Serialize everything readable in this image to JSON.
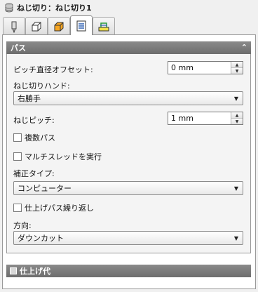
{
  "title": "ねじ切り：ねじ切り1",
  "tabs": [
    {
      "icon": "tool-icon"
    },
    {
      "icon": "holder-icon"
    },
    {
      "icon": "geometry-icon"
    },
    {
      "icon": "passes-icon",
      "active": true
    },
    {
      "icon": "linking-icon"
    }
  ],
  "section": {
    "title": "パス",
    "collapse_icon": "double-chevron-up-icon",
    "pitch_offset": {
      "label": "ピッチ直径オフセット:",
      "value": "0 mm"
    },
    "thread_hand": {
      "label": "ねじ切りハンド:",
      "value": "右勝手"
    },
    "thread_pitch": {
      "label": "ねじピッチ:",
      "value": "1 mm"
    },
    "multiple_passes": {
      "label": "複数パス",
      "checked": false
    },
    "multi_start": {
      "label": "マルチスレッドを実行",
      "checked": false
    },
    "compensation": {
      "label": "補正タイプ:",
      "value": "コンピューター"
    },
    "finishing_repeat": {
      "label": "仕上げパス繰り返し",
      "checked": false
    },
    "direction": {
      "label": "方向:",
      "value": "ダウンカット"
    }
  },
  "footer": {
    "title": "仕上げ代",
    "checked": false
  }
}
